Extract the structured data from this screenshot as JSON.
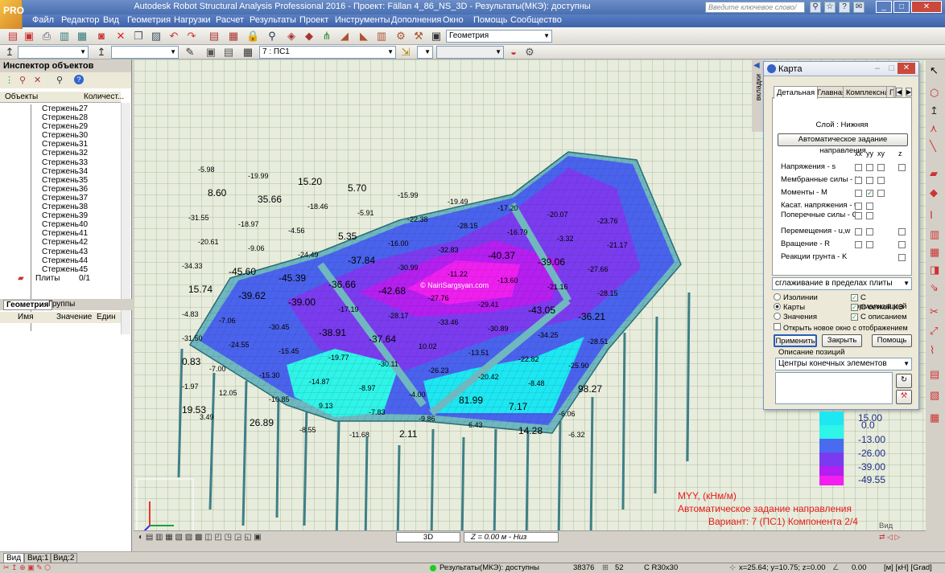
{
  "title": "Autodesk Robot Structural Analysis Professional 2016 - Проект: Fällan 4_86_NS_3D - Результаты(МКЭ): доступны",
  "search_placeholder": "Введите ключевое слово/фразу",
  "logo": "PRO",
  "menu": [
    "Файл",
    "Редактор",
    "Вид",
    "Геометрия",
    "Нагрузки",
    "Расчет",
    "Результаты",
    "Проект",
    "Инструменты",
    "Дополнения",
    "Окно",
    "Помощь",
    "Сообщество"
  ],
  "toolbar": {
    "layout_combo": "Геометрия",
    "case_combo": "7 : ПС1"
  },
  "inspector": {
    "title": "Инспектор объектов",
    "col_objects": "Объекты",
    "col_count": "Количест...",
    "item_label": "Стержень",
    "items": [
      "27",
      "28",
      "29",
      "30",
      "31",
      "32",
      "33",
      "34",
      "35",
      "36",
      "37",
      "38",
      "39",
      "40",
      "41",
      "42",
      "43",
      "44",
      "45"
    ],
    "plates_label": "Плиты",
    "plates_count": "0/1",
    "tab_geometry": "Геометрия",
    "tab_groups": "Группы",
    "prop_cols": [
      "Имя",
      "Значение",
      "Един"
    ]
  },
  "viewport": {
    "watermark": "© NairiSargsyan.com",
    "values": [
      "-5.98",
      "-19.99",
      "15.20",
      "5.70",
      "-15.99",
      "-19.49",
      "-17.20",
      "-20.07",
      "-23.76",
      "8.60",
      "35.66",
      "-18.46",
      "-5.91",
      "-22.38",
      "-28.15",
      "-16.79",
      "-3.32",
      "-21.17",
      "-31.55",
      "-18.97",
      "-4.56",
      "5.35",
      "-16.00",
      "-32.83",
      "-40.37",
      "-39.06",
      "-27.66",
      "-20.61",
      "-9.06",
      "-24.49",
      "-37.84",
      "-30.99",
      "-11.22",
      "-13.60",
      "-21.16",
      "-28.15",
      "-34.33",
      "-45.60",
      "-45.39",
      "-36.66",
      "-42.68",
      "-27.76",
      "-29.41",
      "-43.05",
      "-36.21",
      "15.74",
      "-39.62",
      "-39.00",
      "-17.19",
      "-28.17",
      "-33.46",
      "-30.89",
      "-34.25",
      "-28.51",
      "-4.83",
      "-7.06",
      "-30.45",
      "-38.91",
      "-37.64",
      "10.02",
      "-13.51",
      "-22.82",
      "-25.90",
      "-31.50",
      "-24.55",
      "-15.45",
      "-19.77",
      "-30.11",
      "-26.23",
      "-20.42",
      "-8.48",
      "98.27",
      "0.83",
      "-7.00",
      "-15.30",
      "-14.87",
      "-8.97",
      "-4.00",
      "81.99",
      "7.17",
      "-6.06",
      "-1.97",
      "12.05",
      "-10.85",
      "9.13",
      "-7.83",
      "-9.86",
      "6.43",
      "14.28",
      "-6.32",
      "19.53",
      "3.49",
      "26.89",
      "-8.55",
      "-11.68",
      "2.11"
    ],
    "legend": [
      "15.00",
      "0.0",
      "-13.00",
      "-26.00",
      "-39.00",
      "-49.55"
    ],
    "legend_colors": [
      "#1de7f2",
      "#2ff4e8",
      "#4a6bf0",
      "#7a3bf0",
      "#b21ff0",
      "#f21ff0"
    ],
    "info_line1": "MYY, (кНм/м)",
    "info_line2": "Автоматическое задание направления",
    "info_line3": "Вариант: 7 (ПС1) Компонента 2/4",
    "view_mode": "3D",
    "z_level": "Z = 0.00 м - Низ",
    "view_label": "Вид"
  },
  "map_dialog": {
    "title": "Карта",
    "side_tab": "вкладки",
    "tabs": [
      "Детальная",
      "Главная",
      "Комплексная",
      "Г"
    ],
    "layer": "Слой : Нижняя",
    "auto_dir_button": "Автоматическое задание направления",
    "col_headers": [
      "xx",
      "yy",
      "xy",
      "z"
    ],
    "rows": [
      "Напряжения - s",
      "Мембранные силы - N",
      "Моменты - M",
      "Касат. напряжения - t",
      "Поперечные силы - Q",
      "Перемещения - u,w",
      "Вращение - R",
      "Реакции грунта - K"
    ],
    "smoothing": "сглаживание в пределах плиты",
    "opt_isolines": "Изолинии",
    "opt_maps": "Карты",
    "opt_values": "Значения",
    "chk_normalize": "С нормализацией",
    "chk_mesh": "С сеткой КЭ",
    "chk_desc": "С описанием",
    "chk_newwin": "Открыть новое окно с отображением масшт",
    "btn_apply": "Применить",
    "btn_close": "Закрыть",
    "btn_help": "Помощь",
    "pos_desc_label": "Описание позиций",
    "pos_desc_value": "Центры конечных элементов"
  },
  "bottom_tabs": [
    "Вид",
    "Вид:1",
    "Вид:2"
  ],
  "status": {
    "results": "Результаты(МКЭ): доступны",
    "nodes": "38376",
    "count2": "52",
    "section": "C R30x30",
    "coords": "x=25.64; y=10.75; z=0.00",
    "value": "0.00",
    "units": "[м] [кН] [Grad]"
  }
}
